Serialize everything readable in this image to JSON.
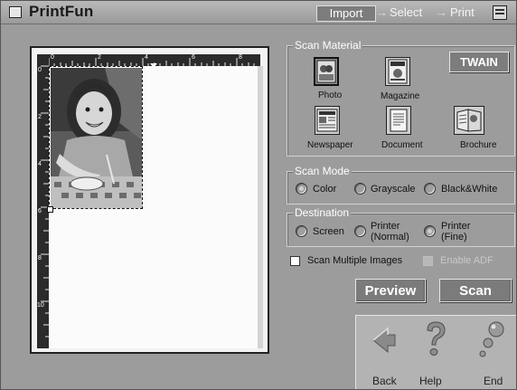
{
  "app": {
    "title": "PrintFun"
  },
  "steps": {
    "import": "Import",
    "select": "Select",
    "print": "Print",
    "arrow": "→"
  },
  "preview": {
    "ruler_top_labels": [
      "0",
      "2",
      "4",
      "6",
      "8"
    ],
    "ruler_left_labels": [
      "0",
      "2",
      "4",
      "6",
      "8",
      "10"
    ]
  },
  "scan_material": {
    "legend": "Scan Material",
    "items": [
      {
        "label": "Photo",
        "icon": "photo-icon",
        "selected": true
      },
      {
        "label": "Magazine",
        "icon": "magazine-icon",
        "selected": false
      },
      {
        "label": "Newspaper",
        "icon": "newspaper-icon",
        "selected": false
      },
      {
        "label": "Document",
        "icon": "document-icon",
        "selected": false
      },
      {
        "label": "Brochure",
        "icon": "brochure-icon",
        "selected": false
      }
    ],
    "twain_label": "TWAIN"
  },
  "scan_mode": {
    "legend": "Scan Mode",
    "options": [
      "Color",
      "Grayscale",
      "Black&White"
    ],
    "selected": "Color"
  },
  "destination": {
    "legend": "Destination",
    "options": [
      {
        "line1": "Screen",
        "line2": ""
      },
      {
        "line1": "Printer",
        "line2": "(Normal)"
      },
      {
        "line1": "Printer",
        "line2": "(Fine)"
      }
    ],
    "selected": "Printer (Fine)"
  },
  "options": {
    "scan_multiple": "Scan Multiple Images",
    "enable_adf": "Enable ADF",
    "enable_adf_disabled": true
  },
  "buttons": {
    "preview": "Preview",
    "scan": "Scan"
  },
  "nav": {
    "back": "Back",
    "help": "Help",
    "end": "End"
  }
}
